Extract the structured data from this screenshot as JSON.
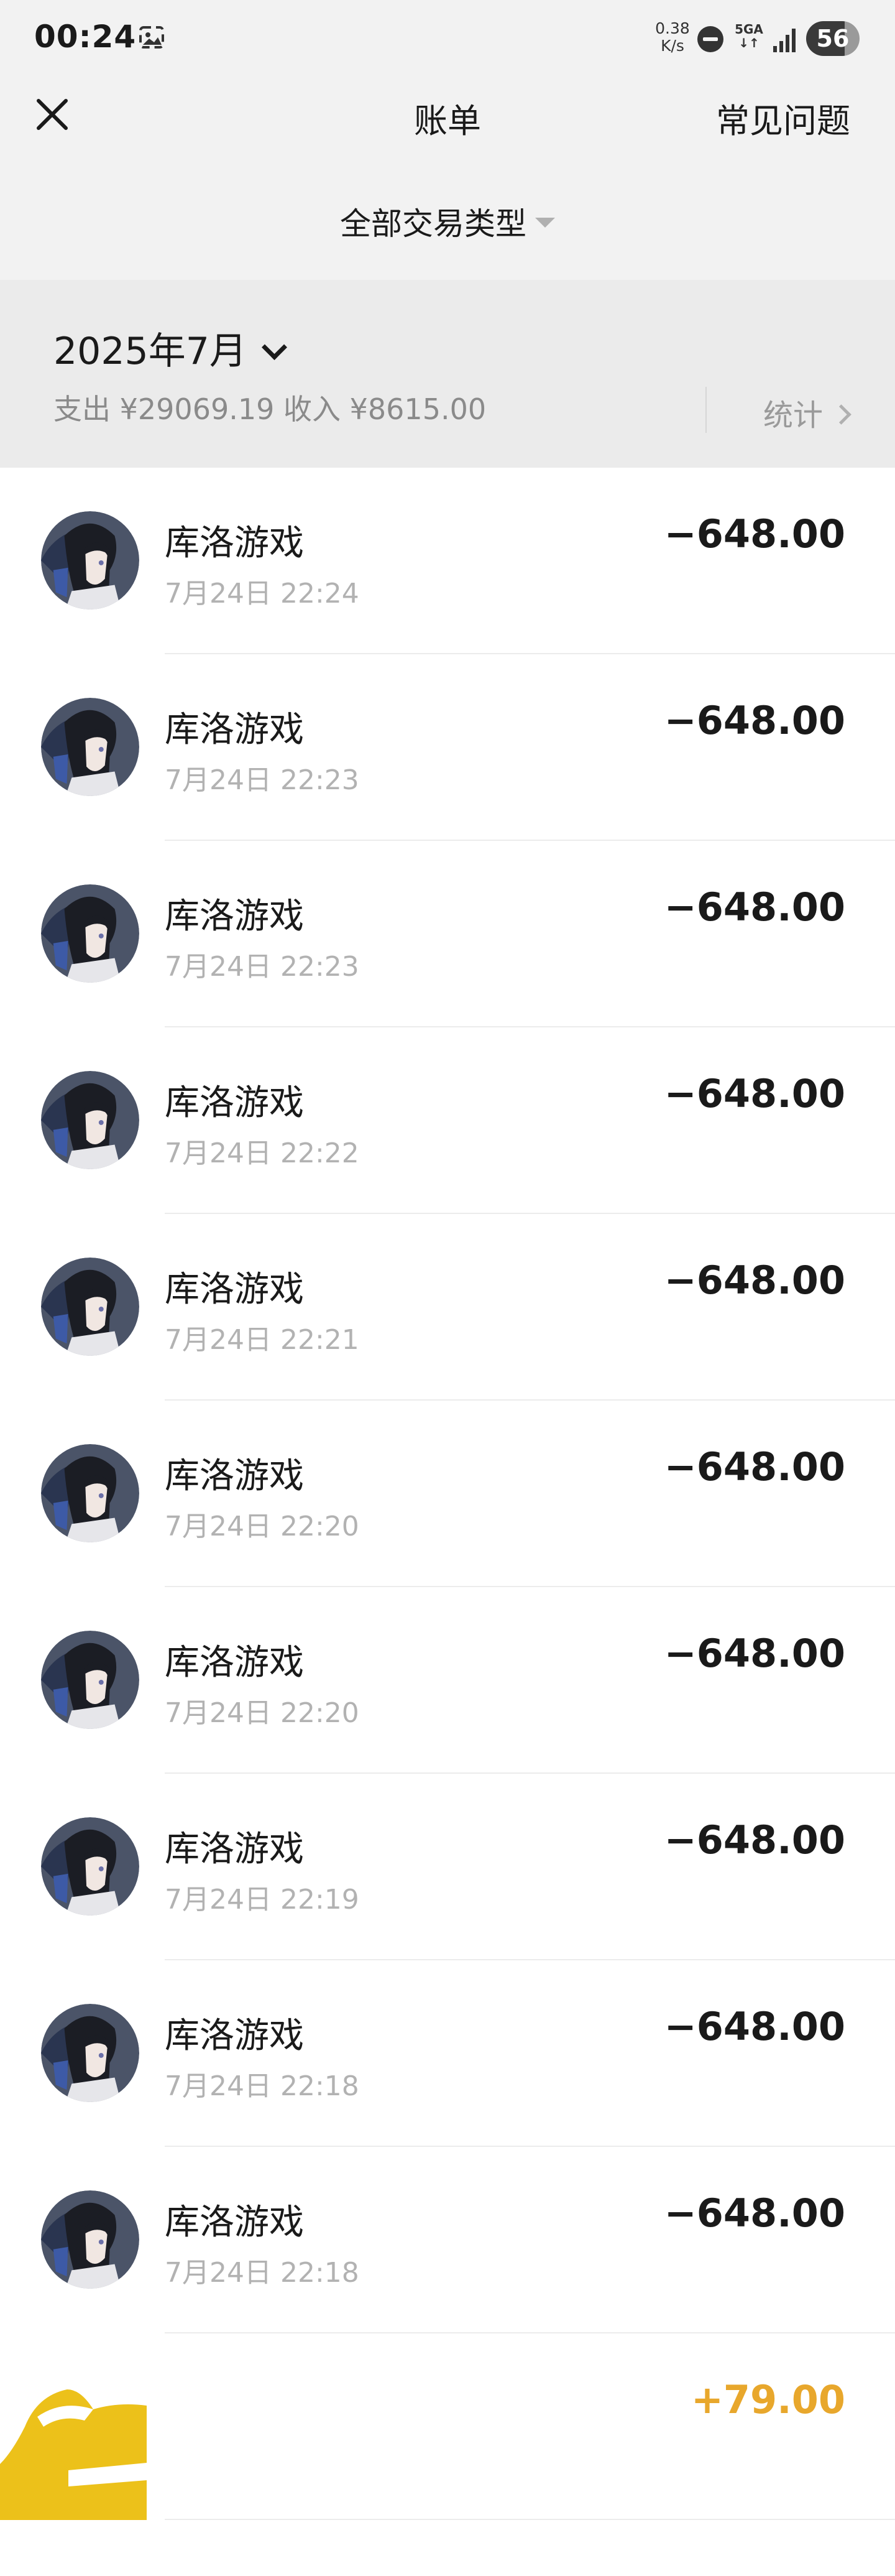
{
  "status_bar": {
    "time": "00:24",
    "net_speed_value": "0.38",
    "net_speed_unit": "K/s",
    "net_type_top": "5GA",
    "net_type_bottom": "↓↑",
    "battery": "56"
  },
  "header": {
    "title": "账单",
    "faq_label": "常见问题",
    "filter_label": "全部交易类型"
  },
  "month": {
    "label": "2025年7月",
    "summary": "支出 ¥29069.19 收入 ¥8615.00",
    "stats_label": "统计"
  },
  "transactions": [
    {
      "name": "库洛游戏",
      "time": "7月24日 22:24",
      "amount": "−648.00"
    },
    {
      "name": "库洛游戏",
      "time": "7月24日 22:23",
      "amount": "−648.00"
    },
    {
      "name": "库洛游戏",
      "time": "7月24日 22:23",
      "amount": "−648.00"
    },
    {
      "name": "库洛游戏",
      "time": "7月24日 22:22",
      "amount": "−648.00"
    },
    {
      "name": "库洛游戏",
      "time": "7月24日 22:21",
      "amount": "−648.00"
    },
    {
      "name": "库洛游戏",
      "time": "7月24日 22:20",
      "amount": "−648.00"
    },
    {
      "name": "库洛游戏",
      "time": "7月24日 22:20",
      "amount": "−648.00"
    },
    {
      "name": "库洛游戏",
      "time": "7月24日 22:19",
      "amount": "−648.00"
    },
    {
      "name": "库洛游戏",
      "time": "7月24日 22:18",
      "amount": "−648.00"
    },
    {
      "name": "库洛游戏",
      "time": "7月24日 22:18",
      "amount": "−648.00"
    },
    {
      "name": "",
      "time": "",
      "amount": "+79.00"
    }
  ],
  "colors": {
    "income": "#e8a72c",
    "expense": "#1a1a1a",
    "muted": "#b2b2b2",
    "header_bg": "#f2f2f2",
    "summary_bg": "#ebebeb"
  },
  "icons": {
    "close": "close-icon",
    "screenshot": "screenshot-icon",
    "dnd": "do-not-disturb-icon",
    "signal": "signal-icon",
    "filter_caret": "caret-down-icon",
    "month_chevron": "chevron-down-icon",
    "stats_chevron": "chevron-right-icon",
    "avatar": "anime-character-avatar",
    "logo": "yellow-brand-logo"
  }
}
